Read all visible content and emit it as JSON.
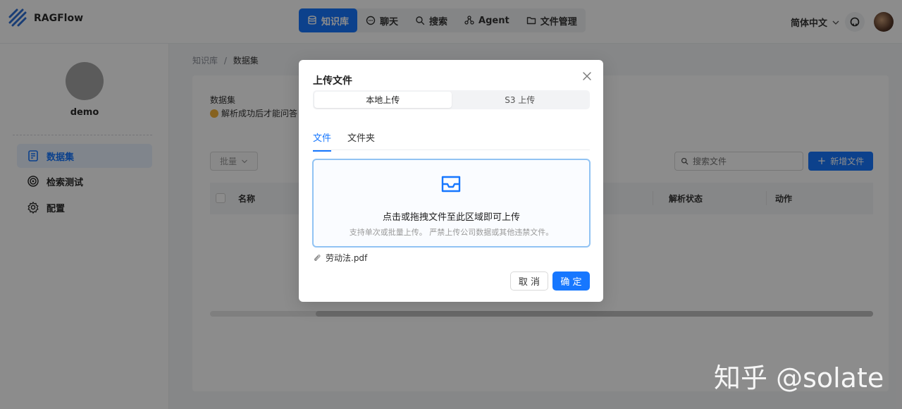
{
  "app": {
    "name": "RAGFlow"
  },
  "nav": {
    "items": [
      {
        "label": "知识库",
        "icon": "database-icon",
        "active": true
      },
      {
        "label": "聊天",
        "icon": "chat-icon",
        "active": false
      },
      {
        "label": "搜索",
        "icon": "search-icon",
        "active": false
      },
      {
        "label": "Agent",
        "icon": "agent-icon",
        "active": false
      },
      {
        "label": "文件管理",
        "icon": "folder-icon",
        "active": false
      }
    ]
  },
  "header": {
    "language": "简体中文"
  },
  "sidebar": {
    "user_name": "demo",
    "items": [
      {
        "label": "数据集",
        "icon": "dataset-icon",
        "active": true
      },
      {
        "label": "检索测试",
        "icon": "target-icon",
        "active": false
      },
      {
        "label": "配置",
        "icon": "gear-icon",
        "active": false
      }
    ]
  },
  "breadcrumb": {
    "root": "知识库",
    "separator": "/",
    "current": "数据集"
  },
  "dataset": {
    "title": "数据集",
    "tip": "解析成功后才能问答",
    "batch_label": "批量",
    "search_placeholder": "搜索文件",
    "new_file_label": "新增文件",
    "columns": [
      "名称",
      "解析状态",
      "动作"
    ]
  },
  "upload_modal": {
    "title": "上传文件",
    "segments": [
      "本地上传",
      "S3 上传"
    ],
    "active_segment": 0,
    "tabs": [
      "文件",
      "文件夹"
    ],
    "active_tab": 0,
    "dropzone_text": "点击或拖拽文件至此区域即可上传",
    "dropzone_hint": "支持单次或批量上传。 严禁上传公司数据或其他违禁文件。",
    "files": [
      "劳动法.pdf"
    ],
    "cancel_label": "取 消",
    "ok_label": "确 定"
  },
  "watermark": "知乎 @solate",
  "colors": {
    "primary": "#1677ff",
    "dropzone_border": "#91c3f3"
  }
}
